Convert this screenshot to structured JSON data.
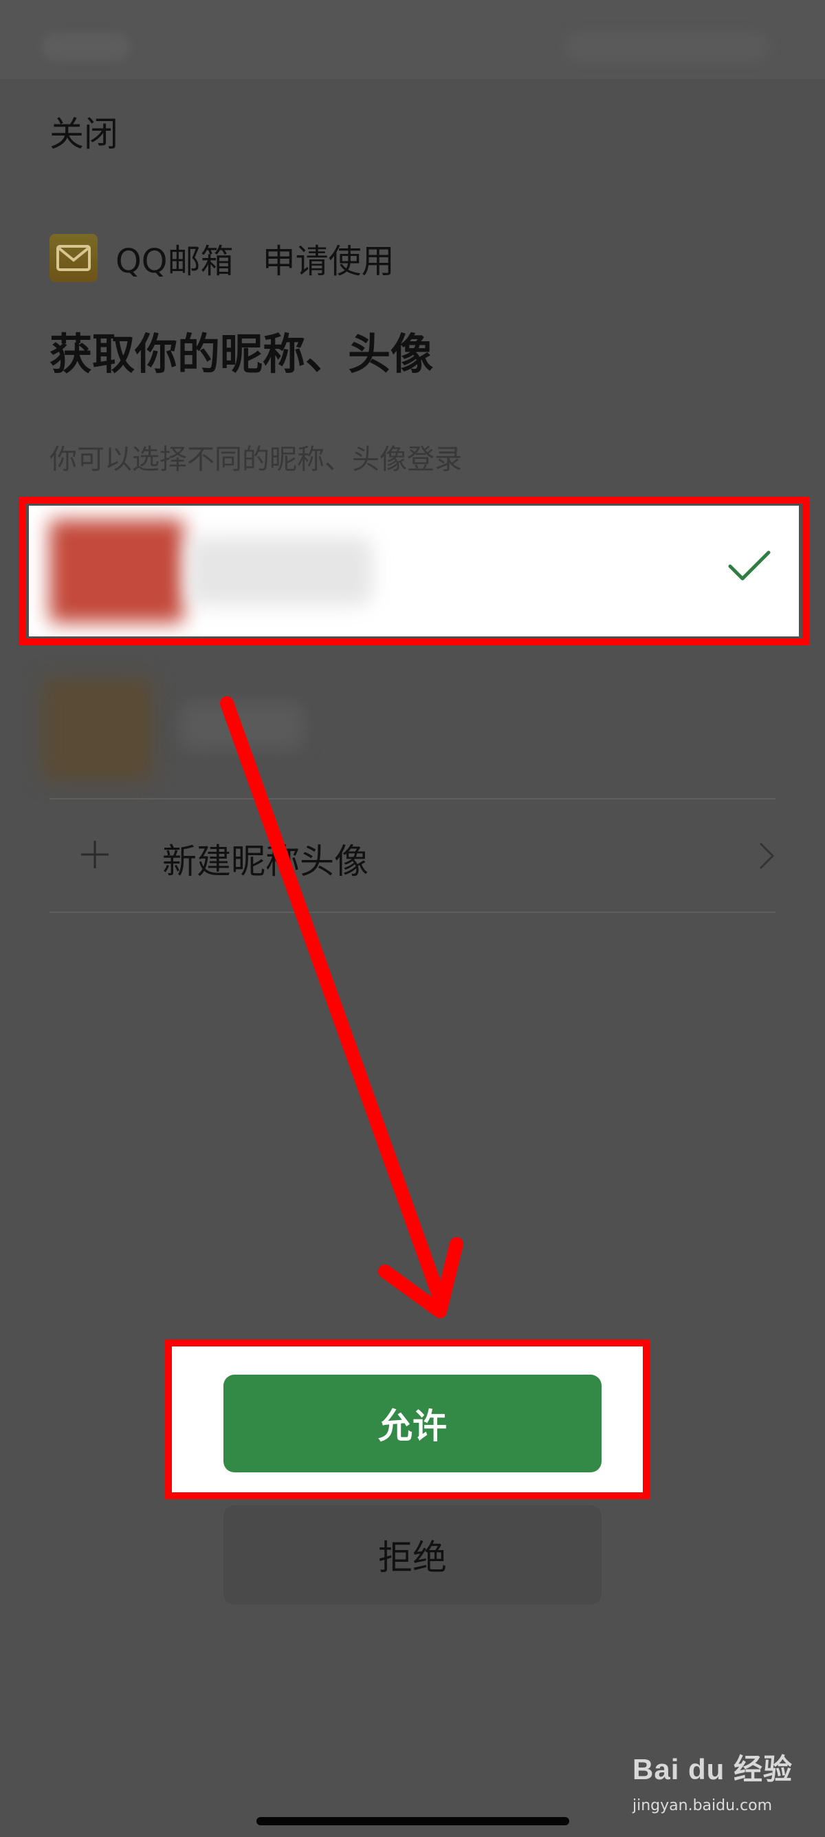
{
  "status_bar": {},
  "header": {
    "close_label": "关闭"
  },
  "app": {
    "name": "QQ邮箱",
    "request_text": "申请使用",
    "logo_icon": "mail-icon"
  },
  "headline": "获取你的昵称、头像",
  "hint": "你可以选择不同的昵称、头像登录",
  "profiles": {
    "selected_icon": "check-icon",
    "new_profile_label": "新建昵称头像",
    "new_profile_icon": "plus-icon",
    "chevron_icon": "chevron-right-icon"
  },
  "buttons": {
    "allow_label": "允许",
    "reject_label": "拒绝"
  },
  "annotation": {
    "highlight_color": "#ff0000",
    "arrow_color": "#ff0000"
  },
  "watermark": {
    "brand": "Bai du 经验",
    "url": "jingyan.baidu.com"
  },
  "colors": {
    "primary_green": "#338a47",
    "check_green": "#2f7d44"
  }
}
